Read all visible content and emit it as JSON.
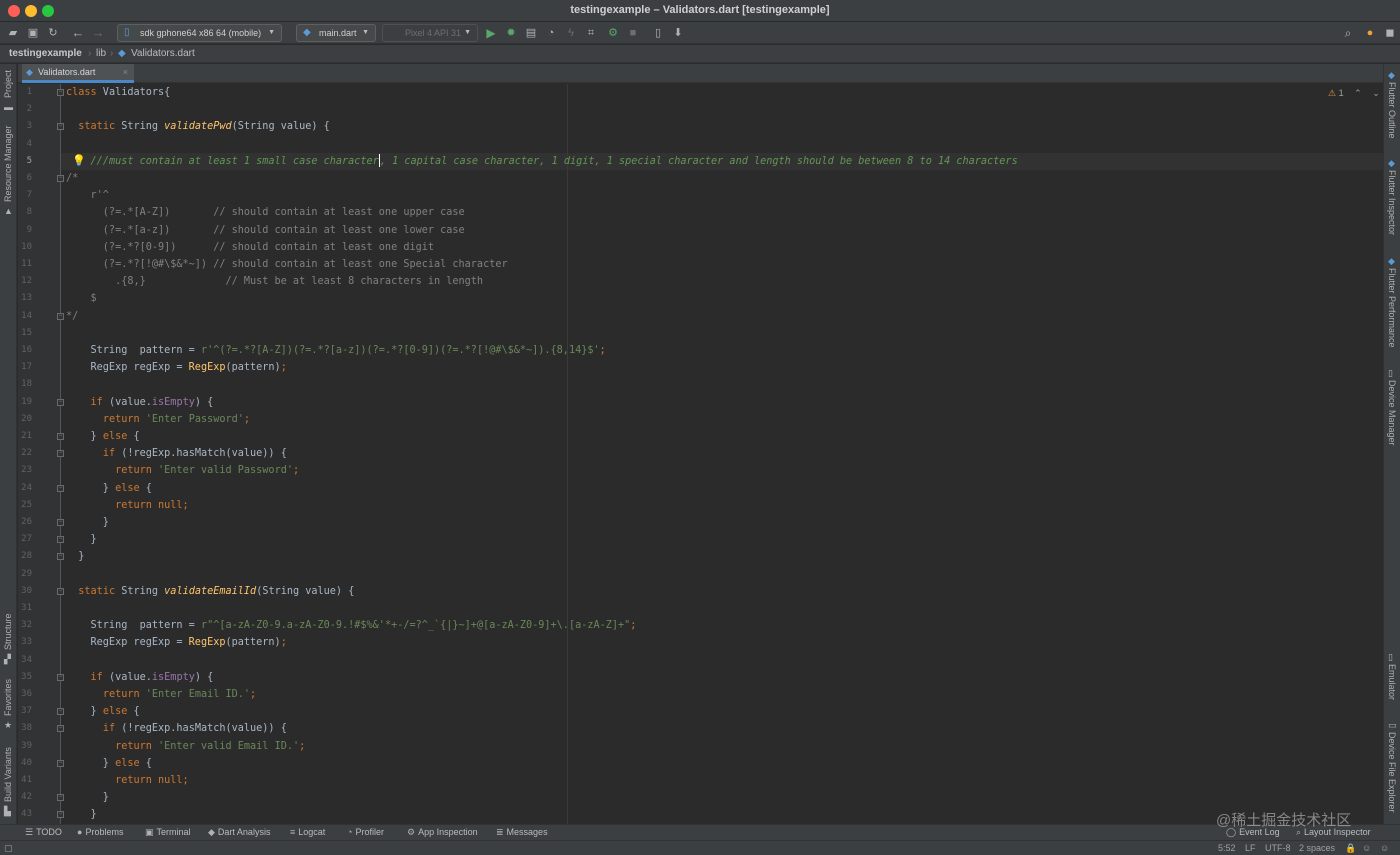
{
  "window": {
    "title": "testingexample – Validators.dart [testingexample]"
  },
  "toolbar": {
    "device_combo": "sdk gphone64 x86 64 (mobile)",
    "config_combo": "main.dart",
    "avd_combo": "Pixel 4 API 31"
  },
  "breadcrumb": {
    "project": "testingexample",
    "folder": "lib",
    "file": "Validators.dart"
  },
  "tabs": {
    "active_file": "Validators.dart",
    "close_glyph": "×"
  },
  "inspection": {
    "warnings": "1"
  },
  "left_tabs": {
    "project": "Project",
    "resource_manager": "Resource Manager",
    "structure": "Structure",
    "favorites": "Favorites",
    "build_variants": "Build Variants"
  },
  "right_tabs": {
    "flutter_outline": "Flutter Outline",
    "flutter_inspector": "Flutter Inspector",
    "flutter_performance": "Flutter Performance",
    "device_manager": "Device Manager",
    "emulator": "Emulator",
    "device_file_explorer": "Device File Explorer"
  },
  "bottom_tabs": {
    "todo": "TODO",
    "problems": "Problems",
    "terminal": "Terminal",
    "dart_analysis": "Dart Analysis",
    "logcat": "Logcat",
    "profiler": "Profiler",
    "app_inspection": "App Inspection",
    "messages": "Messages",
    "event_log": "Event Log",
    "layout_inspector": "Layout Inspector"
  },
  "status": {
    "position": "5:52",
    "line_separator": "LF",
    "encoding": "UTF-8",
    "indent": "2 spaces"
  },
  "watermark": "@稀土掘金技术社区",
  "code": {
    "active_line": 5,
    "lines": [
      [
        [
          "kw",
          "class"
        ],
        [
          "plain",
          " Validators{"
        ]
      ],
      [],
      [
        [
          "plain",
          "  "
        ],
        [
          "kw",
          "static"
        ],
        [
          "plain",
          " String "
        ],
        [
          "fn",
          "validatePwd"
        ],
        [
          "plain",
          "(String value) {"
        ]
      ],
      [],
      [
        [
          "plain",
          "    "
        ],
        [
          "cmt",
          "///must contain at least 1 small case character"
        ],
        [
          "caret",
          ""
        ],
        [
          "cmt",
          ", 1 capital case character, 1 digit, 1 special character and length should be between 8 to 14 characters"
        ]
      ],
      [
        [
          "blk",
          "/*"
        ]
      ],
      [
        [
          "blk",
          "    r'^"
        ]
      ],
      [
        [
          "blk",
          "      (?=.*[A-Z])       // should contain at least one upper case"
        ]
      ],
      [
        [
          "blk",
          "      (?=.*[a-z])       // should contain at least one lower case"
        ]
      ],
      [
        [
          "blk",
          "      (?=.*?[0-9])      // should contain at least one digit"
        ]
      ],
      [
        [
          "blk",
          "      (?=.*?[!@#\\$&*~]) // should contain at least one Special character"
        ]
      ],
      [
        [
          "blk",
          "        .{8,}             // Must be at least 8 characters in length"
        ]
      ],
      [
        [
          "blk",
          "    $"
        ]
      ],
      [
        [
          "blk",
          "*/"
        ]
      ],
      [],
      [
        [
          "plain",
          "    String  pattern = "
        ],
        [
          "str",
          "r'^(?=.*?[A-Z])(?=.*?[a-z])(?=.*?[0-9])(?=.*?[!@#\\$&*~]).{8,14}$'"
        ],
        [
          "kw",
          ";"
        ]
      ],
      [
        [
          "plain",
          "    RegExp regExp = "
        ],
        [
          "call",
          "RegExp"
        ],
        [
          "plain",
          "(pattern)"
        ],
        [
          "kw",
          ";"
        ]
      ],
      [],
      [
        [
          "plain",
          "    "
        ],
        [
          "kw",
          "if"
        ],
        [
          "plain",
          " (value."
        ],
        [
          "prop",
          "isEmpty"
        ],
        [
          "plain",
          ") {"
        ]
      ],
      [
        [
          "plain",
          "      "
        ],
        [
          "kw",
          "return"
        ],
        [
          "plain",
          " "
        ],
        [
          "str",
          "'Enter Password'"
        ],
        [
          "kw",
          ";"
        ]
      ],
      [
        [
          "plain",
          "    } "
        ],
        [
          "kw",
          "else"
        ],
        [
          "plain",
          " {"
        ]
      ],
      [
        [
          "plain",
          "      "
        ],
        [
          "kw",
          "if"
        ],
        [
          "plain",
          " (!regExp.hasMatch(value)) {"
        ]
      ],
      [
        [
          "plain",
          "        "
        ],
        [
          "kw",
          "return"
        ],
        [
          "plain",
          " "
        ],
        [
          "str",
          "'Enter valid Password'"
        ],
        [
          "kw",
          ";"
        ]
      ],
      [
        [
          "plain",
          "      } "
        ],
        [
          "kw",
          "else"
        ],
        [
          "plain",
          " {"
        ]
      ],
      [
        [
          "plain",
          "        "
        ],
        [
          "kw",
          "return null;"
        ]
      ],
      [
        [
          "plain",
          "      }"
        ]
      ],
      [
        [
          "plain",
          "    }"
        ]
      ],
      [
        [
          "plain",
          "  }"
        ]
      ],
      [],
      [
        [
          "plain",
          "  "
        ],
        [
          "kw",
          "static"
        ],
        [
          "plain",
          " String "
        ],
        [
          "fn",
          "validateEmailId"
        ],
        [
          "plain",
          "(String value) {"
        ]
      ],
      [],
      [
        [
          "plain",
          "    String  pattern = "
        ],
        [
          "str",
          "r\"^[a-zA-Z0-9.a-zA-Z0-9.!#$%&'*+-/=?^_`{|}~]+@[a-zA-Z0-9]+\\.[a-zA-Z]+\""
        ],
        [
          "kw",
          ";"
        ]
      ],
      [
        [
          "plain",
          "    RegExp regExp = "
        ],
        [
          "call",
          "RegExp"
        ],
        [
          "plain",
          "(pattern)"
        ],
        [
          "kw",
          ";"
        ]
      ],
      [],
      [
        [
          "plain",
          "    "
        ],
        [
          "kw",
          "if"
        ],
        [
          "plain",
          " (value."
        ],
        [
          "prop",
          "isEmpty"
        ],
        [
          "plain",
          ") {"
        ]
      ],
      [
        [
          "plain",
          "      "
        ],
        [
          "kw",
          "return"
        ],
        [
          "plain",
          " "
        ],
        [
          "str",
          "'Enter Email ID.'"
        ],
        [
          "kw",
          ";"
        ]
      ],
      [
        [
          "plain",
          "    } "
        ],
        [
          "kw",
          "else"
        ],
        [
          "plain",
          " {"
        ]
      ],
      [
        [
          "plain",
          "      "
        ],
        [
          "kw",
          "if"
        ],
        [
          "plain",
          " (!regExp.hasMatch(value)) {"
        ]
      ],
      [
        [
          "plain",
          "        "
        ],
        [
          "kw",
          "return"
        ],
        [
          "plain",
          " "
        ],
        [
          "str",
          "'Enter valid Email ID.'"
        ],
        [
          "kw",
          ";"
        ]
      ],
      [
        [
          "plain",
          "      } "
        ],
        [
          "kw",
          "else"
        ],
        [
          "plain",
          " {"
        ]
      ],
      [
        [
          "plain",
          "        "
        ],
        [
          "kw",
          "return null;"
        ]
      ],
      [
        [
          "plain",
          "      }"
        ]
      ],
      [
        [
          "plain",
          "    }"
        ]
      ]
    ],
    "fold_lines": [
      1,
      3,
      6,
      14,
      19,
      21,
      22,
      24,
      26,
      27,
      28,
      30,
      35,
      37,
      38,
      40,
      42,
      43
    ]
  }
}
